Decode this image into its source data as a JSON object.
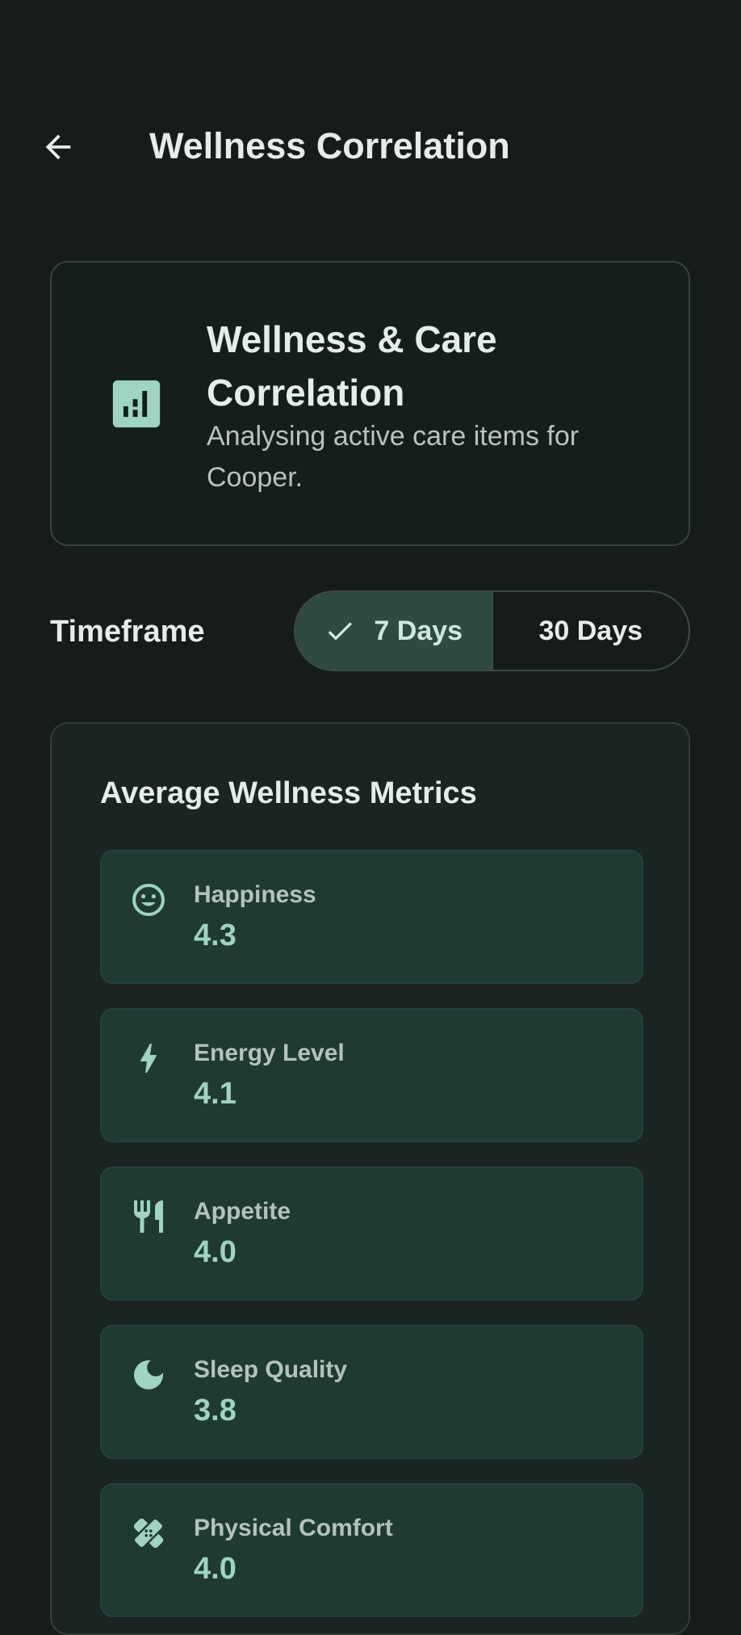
{
  "header": {
    "title": "Wellness Correlation"
  },
  "summary_card": {
    "icon": "bar-chart-icon",
    "title": "Wellness & Care Correlation",
    "subtitle": "Analysing active care items for Cooper."
  },
  "timeframe": {
    "label": "Timeframe",
    "options": [
      {
        "label": "7 Days",
        "selected": true
      },
      {
        "label": "30 Days",
        "selected": false
      }
    ]
  },
  "metrics": {
    "title": "Average Wellness Metrics",
    "items": [
      {
        "icon": "happy-face-icon",
        "label": "Happiness",
        "value": "4.3"
      },
      {
        "icon": "lightning-icon",
        "label": "Energy Level",
        "value": "4.1"
      },
      {
        "icon": "fork-knife-icon",
        "label": "Appetite",
        "value": "4.0"
      },
      {
        "icon": "moon-icon",
        "label": "Sleep Quality",
        "value": "3.8"
      },
      {
        "icon": "bandage-icon",
        "label": "Physical Comfort",
        "value": "4.0"
      }
    ]
  },
  "colors": {
    "background": "#161c1b",
    "accent": "#9fd3c2",
    "metric_tile": "#1f3933",
    "selected_segment": "#2f4a43"
  }
}
